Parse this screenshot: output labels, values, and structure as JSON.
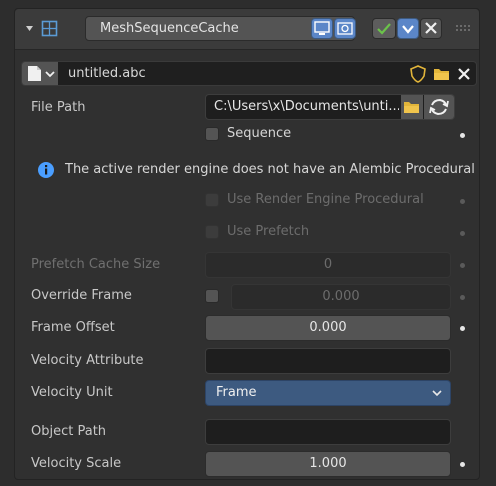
{
  "header": {
    "modifier_name": "MeshSequenceCache",
    "icons": [
      "collapse-arrow-icon",
      "modifier-type-icon",
      "realtime-display-icon",
      "render-icon",
      "edit-mode-toggle-icon",
      "cage-dropdown-icon",
      "remove-icon",
      "drag-handle-icon"
    ]
  },
  "cache_file": {
    "name": "untitled.abc"
  },
  "file_path": {
    "label": "File Path",
    "value": "C:\\Users\\x\\Documents\\unti..."
  },
  "sequence": {
    "label": "Sequence"
  },
  "info_message": "The active render engine does not have an Alembic Procedural",
  "use_render_engine_procedural": {
    "label": "Use Render Engine Procedural"
  },
  "use_prefetch": {
    "label": "Use Prefetch"
  },
  "prefetch_cache_size": {
    "label": "Prefetch Cache Size",
    "value": "0"
  },
  "override_frame": {
    "label": "Override Frame",
    "value": "0.000"
  },
  "frame_offset": {
    "label": "Frame Offset",
    "value": "0.000"
  },
  "velocity_attribute": {
    "label": "Velocity Attribute",
    "value": ""
  },
  "velocity_unit": {
    "label": "Velocity Unit",
    "value": "Frame"
  },
  "object_path": {
    "label": "Object Path",
    "value": ""
  },
  "velocity_scale": {
    "label": "Velocity Scale",
    "value": "1.000"
  },
  "colors": {
    "panel_bg": "#303030",
    "field_bg": "#1e1e1e",
    "accent_blue": "#3d5a80",
    "toggle_blue": "#5b86c8",
    "check_green": "#6bc34a",
    "folder_yellow": "#e2b53a",
    "info_blue": "#4a9eff"
  }
}
